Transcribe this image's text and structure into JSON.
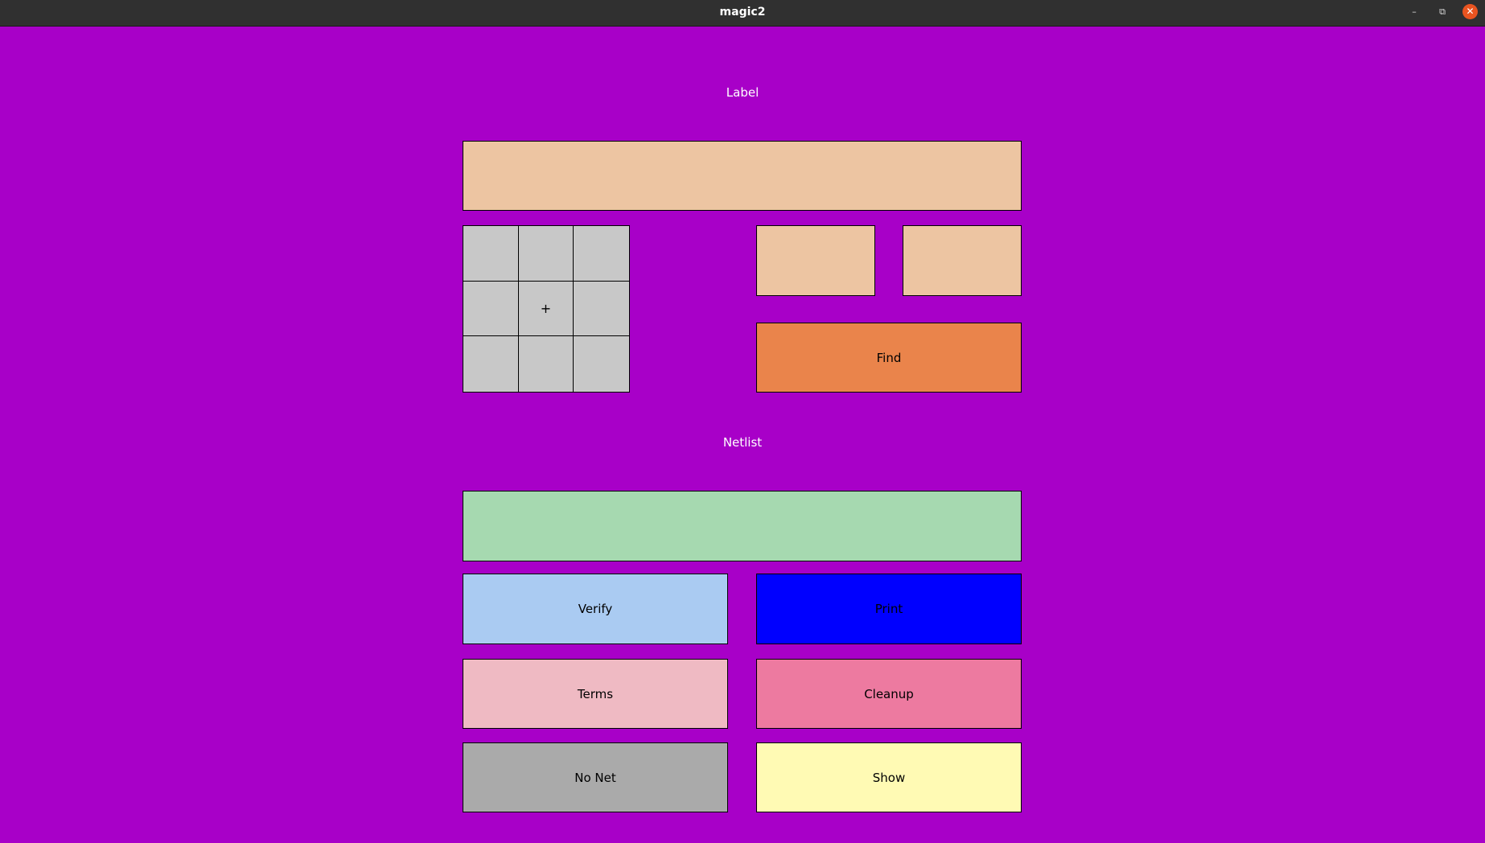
{
  "window": {
    "title": "magic2",
    "controls": [
      "minimize-icon",
      "restore-icon",
      "close-icon"
    ]
  },
  "label_section": {
    "heading": "Label",
    "entry_value": "",
    "small_entry_1": "",
    "small_entry_2": "",
    "find_label": "Find"
  },
  "grid": {
    "center_glyph": "+"
  },
  "netlist_section": {
    "heading": "Netlist",
    "entry_value": ""
  },
  "buttons": {
    "verify": "Verify",
    "print": "Print",
    "terms": "Terms",
    "cleanup": "Cleanup",
    "no_net": "No Net",
    "show": "Show"
  },
  "colors": {
    "background": "#a800c8",
    "entry": "#edc5a2",
    "grid": "#c8c8c8",
    "find": "#ea844b",
    "netlist_entry": "#a6d9b0",
    "verify": "#aacbf2",
    "print": "#0000ff",
    "terms": "#efbac3",
    "cleanup": "#ed7aa0",
    "no_net": "#aaaaaa",
    "show": "#fffab4"
  }
}
